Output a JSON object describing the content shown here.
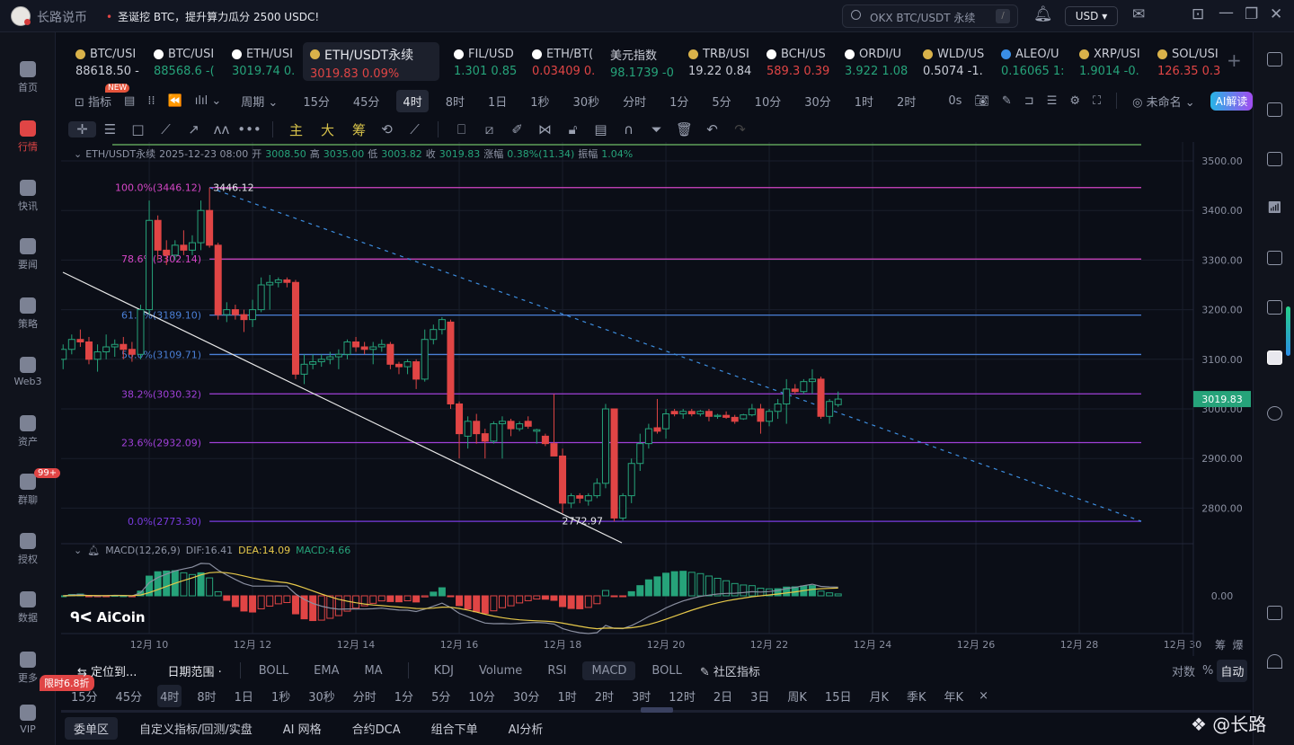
{
  "titlebar": {
    "app_name": "长路说币",
    "announcement": "圣诞挖 BTC，提升算力瓜分 2500 USDC!",
    "search_placeholder": "OKX BTC/USDT 永续",
    "search_shortcut": "/",
    "currency": "USD"
  },
  "sidebar": {
    "items": [
      {
        "label": "首页"
      },
      {
        "label": "行情",
        "active": true
      },
      {
        "label": "快讯"
      },
      {
        "label": "要闻"
      },
      {
        "label": "策略"
      },
      {
        "label": "Web3"
      },
      {
        "label": "资产"
      },
      {
        "label": "群聊",
        "badge": "99+"
      },
      {
        "label": "授权"
      },
      {
        "label": "数据"
      },
      {
        "label": "更多"
      },
      {
        "label": "VIP",
        "promo": "限时6.8折"
      }
    ]
  },
  "tickers": [
    {
      "symbol": "BTC/USI",
      "price": "88618.50",
      "change": "-",
      "color": "#c9ccd6",
      "icon": "#d9b24a"
    },
    {
      "symbol": "BTC/USI",
      "price": "88568.6",
      "change": "-(",
      "color": "#26a37a",
      "icon": "#ffffff"
    },
    {
      "symbol": "ETH/USI",
      "price": "3019.74",
      "change": "0.",
      "color": "#26a37a",
      "icon": "#ffffff"
    },
    {
      "symbol": "ETH/USDT永续",
      "price": "3019.83",
      "change": "0.09%",
      "color": "#e04545",
      "icon": "#d9b24a",
      "active": true
    },
    {
      "symbol": "FIL/USD",
      "price": "1.301",
      "change": "0.85",
      "color": "#26a37a",
      "icon": "#ffffff"
    },
    {
      "symbol": "ETH/BT(",
      "price": "0.03409",
      "change": "0.",
      "color": "#e04545",
      "icon": "#ffffff"
    },
    {
      "symbol": "美元指数",
      "price": "98.1739",
      "change": "-0",
      "color": "#26a37a",
      "icon": ""
    },
    {
      "symbol": "TRB/USI",
      "price": "19.22",
      "change": "0.84",
      "color": "#c9ccd6",
      "icon": "#d9b24a"
    },
    {
      "symbol": "BCH/US",
      "price": "589.3",
      "change": "0.39",
      "color": "#e04545",
      "icon": "#ffffff"
    },
    {
      "symbol": "ORDI/U",
      "price": "3.922",
      "change": "1.08",
      "color": "#26a37a",
      "icon": "#ffffff"
    },
    {
      "symbol": "WLD/US",
      "price": "0.5074",
      "change": "-1.",
      "color": "#c9ccd6",
      "icon": "#d9b24a"
    },
    {
      "symbol": "ALEO/U",
      "price": "0.16065",
      "change": "1:",
      "color": "#26a37a",
      "icon": "#3a8ee6"
    },
    {
      "symbol": "XRP/USI",
      "price": "1.9014",
      "change": "-0.",
      "color": "#26a37a",
      "icon": "#d9b24a"
    },
    {
      "symbol": "SOL/USI",
      "price": "126.35",
      "change": "0.3",
      "color": "#e04545",
      "icon": "#d9b24a"
    }
  ],
  "toolbar": {
    "indicator_label": "指标",
    "new_badge": "NEW",
    "period_label": "周期",
    "timeframes": [
      "15分",
      "45分",
      "4时",
      "8时",
      "1日",
      "1秒",
      "30秒",
      "分时",
      "1分",
      "5分",
      "10分",
      "30分",
      "1时",
      "2时"
    ],
    "active_timeframe": "4时",
    "countdown": "0s",
    "layout_name": "未命名",
    "ai_button": "AI解读"
  },
  "drawing_toolbar": {
    "chips": [
      "主",
      "大",
      "筹"
    ]
  },
  "info_line": {
    "symbol": "ETH/USDT永续",
    "datetime": "2025-12-23 08:00",
    "open_label": "开",
    "open": "3008.50",
    "high_label": "高",
    "high": "3035.00",
    "low_label": "低",
    "low": "3003.82",
    "close_label": "收",
    "close": "3019.83",
    "change_label": "涨幅",
    "change": "0.38%(11.34)",
    "amplitude_label": "振幅",
    "amplitude": "1.04%"
  },
  "chart_data": {
    "type": "candlestick",
    "interval": "4h",
    "first_candle": "2025-12-08 08:00",
    "candles": [
      [
        3100,
        3130,
        3080,
        3120
      ],
      [
        3120,
        3150,
        3110,
        3140
      ],
      [
        3140,
        3160,
        3125,
        3135
      ],
      [
        3135,
        3145,
        3090,
        3100
      ],
      [
        3100,
        3130,
        3075,
        3115
      ],
      [
        3115,
        3150,
        3100,
        3125
      ],
      [
        3125,
        3140,
        3105,
        3130
      ],
      [
        3130,
        3145,
        3100,
        3120
      ],
      [
        3120,
        3135,
        3095,
        3110
      ],
      [
        3110,
        3210,
        3100,
        3200
      ],
      [
        3200,
        3420,
        3190,
        3380
      ],
      [
        3380,
        3390,
        3300,
        3320
      ],
      [
        3320,
        3340,
        3290,
        3310
      ],
      [
        3310,
        3340,
        3300,
        3330
      ],
      [
        3330,
        3360,
        3310,
        3320
      ],
      [
        3320,
        3350,
        3310,
        3335
      ],
      [
        3335,
        3420,
        3320,
        3400
      ],
      [
        3400,
        3446.12,
        3325,
        3330
      ],
      [
        3330,
        3335,
        3180,
        3190
      ],
      [
        3190,
        3215,
        3175,
        3200
      ],
      [
        3200,
        3210,
        3180,
        3190
      ],
      [
        3190,
        3200,
        3155,
        3180
      ],
      [
        3180,
        3220,
        3165,
        3200
      ],
      [
        3200,
        3265,
        3195,
        3250
      ],
      [
        3250,
        3270,
        3200,
        3255
      ],
      [
        3255,
        3265,
        3245,
        3260
      ],
      [
        3260,
        3265,
        3245,
        3255
      ],
      [
        3255,
        3260,
        3060,
        3070
      ],
      [
        3070,
        3110,
        3050,
        3090
      ],
      [
        3090,
        3110,
        3080,
        3095
      ],
      [
        3095,
        3110,
        3085,
        3100
      ],
      [
        3100,
        3115,
        3090,
        3105
      ],
      [
        3105,
        3120,
        3080,
        3110
      ],
      [
        3110,
        3140,
        3100,
        3135
      ],
      [
        3135,
        3145,
        3115,
        3125
      ],
      [
        3125,
        3135,
        3110,
        3120
      ],
      [
        3120,
        3135,
        3090,
        3125
      ],
      [
        3125,
        3140,
        3115,
        3130
      ],
      [
        3130,
        3135,
        3080,
        3090
      ],
      [
        3090,
        3095,
        3070,
        3085
      ],
      [
        3085,
        3100,
        3070,
        3095
      ],
      [
        3095,
        3100,
        3040,
        3060
      ],
      [
        3060,
        3160,
        3055,
        3140
      ],
      [
        3140,
        3170,
        3130,
        3160
      ],
      [
        3160,
        3185,
        3150,
        3180
      ],
      [
        3175,
        3180,
        3000,
        3010
      ],
      [
        3010,
        3015,
        2900,
        2950
      ],
      [
        2945,
        2985,
        2920,
        2975
      ],
      [
        2975,
        2990,
        2930,
        2950
      ],
      [
        2950,
        2960,
        2900,
        2935
      ],
      [
        2935,
        2975,
        2930,
        2970
      ],
      [
        2970,
        2985,
        2900,
        2975
      ],
      [
        2975,
        2980,
        2945,
        2960
      ],
      [
        2960,
        2975,
        2955,
        2970
      ],
      [
        2975,
        2985,
        2960,
        2965
      ],
      [
        2955,
        2960,
        2930,
        2958
      ],
      [
        2945,
        2950,
        2925,
        2930
      ],
      [
        2930,
        3030,
        2905,
        2905
      ],
      [
        2905,
        2920,
        2790,
        2810
      ],
      [
        2810,
        2830,
        2800,
        2825
      ],
      [
        2825,
        2830,
        2810,
        2820
      ],
      [
        2815,
        2830,
        2805,
        2825
      ],
      [
        2825,
        2860,
        2820,
        2850
      ],
      [
        2850,
        3010,
        2840,
        3000
      ],
      [
        3000,
        3000,
        2772.97,
        2780
      ],
      [
        2780,
        2830,
        2775,
        2825
      ],
      [
        2825,
        2900,
        2810,
        2890
      ],
      [
        2890,
        2950,
        2875,
        2930
      ],
      [
        2930,
        2970,
        2920,
        2960
      ],
      [
        2962,
        3020,
        2950,
        2955
      ],
      [
        2960,
        3000,
        2940,
        2990
      ],
      [
        2995,
        3000,
        2985,
        2990
      ],
      [
        2990,
        3000,
        2980,
        2995
      ],
      [
        2995,
        3000,
        2985,
        2990
      ],
      [
        2990,
        2998,
        2985,
        2995
      ],
      [
        2995,
        3000,
        2975,
        2985
      ],
      [
        2985,
        2990,
        2980,
        2987
      ],
      [
        2987,
        2995,
        2980,
        2983
      ],
      [
        2983,
        2988,
        2970,
        2975
      ],
      [
        2980,
        2990,
        2978,
        2988
      ],
      [
        2988,
        3010,
        2985,
        3000
      ],
      [
        3000,
        3010,
        2950,
        2975
      ],
      [
        2975,
        3000,
        2965,
        2995
      ],
      [
        2995,
        3020,
        2980,
        3010
      ],
      [
        3010,
        3060,
        2970,
        3040
      ],
      [
        3040,
        3050,
        3030,
        3035
      ],
      [
        3035,
        3060,
        3030,
        3055
      ],
      [
        3055,
        3080,
        3030,
        3060
      ],
      [
        3060,
        3065,
        2980,
        2985
      ],
      [
        2985,
        3020,
        2970,
        3015
      ],
      [
        3008.5,
        3035,
        3003.82,
        3019.83
      ]
    ],
    "y_ticks": [
      "3500.00",
      "3400.00",
      "3300.00",
      "3200.00",
      "3100.00",
      "3000.00",
      "2900.00",
      "2800.00"
    ],
    "x_ticks": [
      {
        "label": "12月 10",
        "date": "2025-12-10"
      },
      {
        "label": "12月 12",
        "date": "2025-12-12"
      },
      {
        "label": "12月 14",
        "date": "2025-12-14"
      },
      {
        "label": "12月 16",
        "date": "2025-12-16"
      },
      {
        "label": "12月 18",
        "date": "2025-12-18"
      },
      {
        "label": "12月 20",
        "date": "2025-12-20"
      },
      {
        "label": "12月 22",
        "date": "2025-12-22"
      },
      {
        "label": "12月 24",
        "date": "2025-12-24"
      },
      {
        "label": "12月 26",
        "date": "2025-12-26"
      },
      {
        "label": "12月 28",
        "date": "2025-12-28"
      },
      {
        "label": "12月 30",
        "date": "2025-12-30"
      }
    ],
    "fib_levels": [
      {
        "label": "100.0%(3446.12)",
        "price": 3446.12,
        "color": "#d546c6"
      },
      {
        "label": "78.6%(3302.14)",
        "price": 3302.14,
        "color": "#d546c6"
      },
      {
        "label": "61.8%(3189.10)",
        "price": 3189.1,
        "color": "#4a7fd6"
      },
      {
        "label": "50.0%(3109.71)",
        "price": 3109.71,
        "color": "#4a7fd6"
      },
      {
        "label": "38.2%(3030.32)",
        "price": 3030.32,
        "color": "#a040d8"
      },
      {
        "label": "23.6%(2932.09)",
        "price": 2932.09,
        "color": "#a040d8"
      },
      {
        "label": "0.0%(2773.30)",
        "price": 2773.3,
        "color": "#7a3be0"
      }
    ],
    "high_marker": "3446.12",
    "low_marker": "2772.97",
    "last_price": "3019.83",
    "colors": {
      "up": "#26a37a",
      "down": "#e04545",
      "dif": "#8a8fa0",
      "dea": "#e6c84a",
      "trendline": "#e8e8e8",
      "dashed": "#3d8ee0",
      "grid": "#1a1f2c"
    },
    "grid": true
  },
  "macd": {
    "label": "MACD(12,26,9)",
    "dif": "DIF:16.41",
    "dea": "DEA:14.09",
    "macd": "MACD:4.66",
    "zero_label": "0.00"
  },
  "watermark": {
    "brand": "AiCoin",
    "author": "@长路"
  },
  "bottom": {
    "locate": "定位到...",
    "date_range": "日期范围",
    "indicators": [
      "BOLL",
      "EMA",
      "MA",
      "KDJ",
      "Volume",
      "RSI",
      "MACD",
      "BOLL"
    ],
    "active_indicator": "MACD",
    "community": "社区指标",
    "scale_options": [
      "对数",
      "%",
      "自动"
    ],
    "timeframes": [
      "15分",
      "45分",
      "4时",
      "8时",
      "1日",
      "1秒",
      "30秒",
      "分时",
      "1分",
      "5分",
      "10分",
      "30分",
      "1时",
      "2时",
      "3时",
      "12时",
      "2日",
      "3日",
      "周K",
      "15日",
      "月K",
      "季K",
      "年K"
    ],
    "close": "×",
    "tabs": [
      "委单区",
      "自定义指标/回测/实盘",
      "AI 网格",
      "合约DCA",
      "组合下单",
      "AI分析"
    ],
    "corner": [
      "筹",
      "爆"
    ]
  }
}
